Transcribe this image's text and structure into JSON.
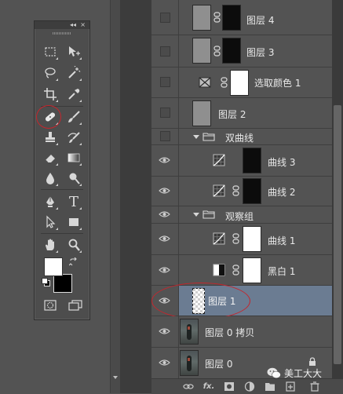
{
  "toolbox": {
    "collapse_glyph": "◂◂",
    "close_glyph": "×",
    "tools": [
      {
        "name": "rectangular-marquee-icon"
      },
      {
        "name": "move-icon"
      },
      {
        "name": "lasso-icon"
      },
      {
        "name": "magic-wand-icon"
      },
      {
        "name": "crop-icon"
      },
      {
        "name": "eyedropper-icon"
      },
      {
        "name": "spot-healing-brush-icon"
      },
      {
        "name": "brush-icon"
      },
      {
        "name": "clone-stamp-icon"
      },
      {
        "name": "history-brush-icon"
      },
      {
        "name": "eraser-icon"
      },
      {
        "name": "gradient-icon"
      },
      {
        "name": "blur-icon"
      },
      {
        "name": "dodge-icon"
      },
      {
        "name": "pen-icon"
      },
      {
        "name": "type-icon"
      },
      {
        "name": "path-selection-icon"
      },
      {
        "name": "rectangle-shape-icon"
      },
      {
        "name": "hand-icon"
      },
      {
        "name": "zoom-icon"
      }
    ],
    "type_tool_glyph": "T",
    "foreground_color": "#ffffff",
    "background_color": "#000000"
  },
  "layers": {
    "rows": [
      {
        "name": "图层 4",
        "visible": false,
        "kind": "pixel-with-mask"
      },
      {
        "name": "图层 3",
        "visible": false,
        "kind": "pixel-with-mask"
      },
      {
        "name": "选取颜色 1",
        "visible": false,
        "kind": "adjustment-selective-color"
      },
      {
        "name": "图层 2",
        "visible": false,
        "kind": "pixel"
      },
      {
        "name": "双曲线",
        "visible": false,
        "kind": "group",
        "expanded": true
      },
      {
        "name": "曲线 3",
        "visible": true,
        "kind": "adjustment-curves"
      },
      {
        "name": "曲线 2",
        "visible": true,
        "kind": "adjustment-curves"
      },
      {
        "name": "观察组",
        "visible": true,
        "kind": "group",
        "expanded": true
      },
      {
        "name": "曲线 1",
        "visible": true,
        "kind": "adjustment-curves"
      },
      {
        "name": "黑白 1",
        "visible": true,
        "kind": "adjustment-black-white"
      },
      {
        "name": "图层 1",
        "visible": true,
        "kind": "pixel",
        "selected": true
      },
      {
        "name": "图层 0 拷贝",
        "visible": true,
        "kind": "photo"
      },
      {
        "name": "图层 0",
        "visible": true,
        "kind": "photo",
        "locked": true
      }
    ]
  },
  "bottom_bar": {
    "fx_label": "fx."
  },
  "watermark": {
    "text": "美工大大"
  },
  "colors": {
    "selected_row": "#6b7c92",
    "annotation_red": "#c4262d"
  }
}
